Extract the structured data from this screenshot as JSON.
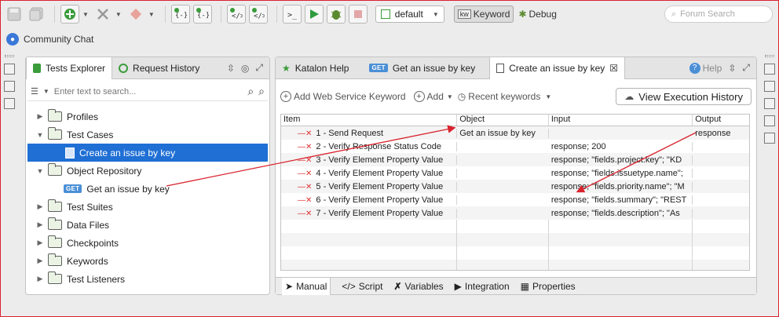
{
  "toolbar": {
    "profile": "default",
    "mode_keyword": "Keyword",
    "mode_debug": "Debug",
    "search_placeholder": "Forum Search"
  },
  "community_chat": "Community Chat",
  "left_panel": {
    "tabs": [
      "Tests Explorer",
      "Request History"
    ],
    "filter_placeholder": "Enter text to search...",
    "tree": [
      {
        "label": "Profiles",
        "level": 0,
        "arrow": "▶",
        "icon": "profile-folder-icon"
      },
      {
        "label": "Test Cases",
        "level": 0,
        "arrow": "▼",
        "icon": "folder-icon"
      },
      {
        "label": "Create an issue by key",
        "level": 1,
        "arrow": "",
        "icon": "test-case-icon",
        "selected": true
      },
      {
        "label": "Object Repository",
        "level": 0,
        "arrow": "▼",
        "icon": "folder-icon"
      },
      {
        "label": "Get an issue by key",
        "level": 1,
        "arrow": "",
        "icon": "get-request-icon",
        "badge": "GET"
      },
      {
        "label": "Test Suites",
        "level": 0,
        "arrow": "▶",
        "icon": "folder-icon"
      },
      {
        "label": "Data Files",
        "level": 0,
        "arrow": "▶",
        "icon": "folder-icon"
      },
      {
        "label": "Checkpoints",
        "level": 0,
        "arrow": "▶",
        "icon": "folder-icon"
      },
      {
        "label": "Keywords",
        "level": 0,
        "arrow": "▶",
        "icon": "folder-icon"
      },
      {
        "label": "Test Listeners",
        "level": 0,
        "arrow": "▶",
        "icon": "folder-icon"
      }
    ]
  },
  "editor": {
    "tabs": [
      {
        "label": "Katalon Help",
        "badge": ""
      },
      {
        "label": "Get an issue by key",
        "badge": "GET"
      },
      {
        "label": "Create an issue by key",
        "badge": "",
        "active": true
      }
    ],
    "help_label": "Help",
    "add_ws_keyword": "Add Web Service Keyword",
    "add": "Add",
    "recent_keywords": "Recent keywords",
    "view_execution_history": "View Execution History",
    "columns": [
      "Item",
      "Object",
      "Input",
      "Output"
    ],
    "rows": [
      {
        "item": "1 - Send Request",
        "object": "Get an issue by key",
        "input": "",
        "output": "response"
      },
      {
        "item": "2 - Verify Response Status Code",
        "object": "",
        "input": "response; 200",
        "output": ""
      },
      {
        "item": "3 - Verify Element Property Value",
        "object": "",
        "input": "response; \"fields.project.key\"; \"KD",
        "output": ""
      },
      {
        "item": "4 - Verify Element Property Value",
        "object": "",
        "input": "response; \"fields.issuetype.name\";",
        "output": ""
      },
      {
        "item": "5 - Verify Element Property Value",
        "object": "",
        "input": "response; \"fields.priority.name\"; \"M",
        "output": ""
      },
      {
        "item": "6 - Verify Element Property Value",
        "object": "",
        "input": "response; \"fields.summary\"; \"REST",
        "output": ""
      },
      {
        "item": "7 - Verify Element Property Value",
        "object": "",
        "input": "response; \"fields.description\"; \"As",
        "output": ""
      }
    ],
    "bottom_tabs": [
      "Manual",
      "Script",
      "Variables",
      "Integration",
      "Properties"
    ]
  },
  "colors": {
    "selection": "#1f6fd4",
    "annotation_arrow": "#d9232e",
    "run_green": "#2e9b3e"
  }
}
